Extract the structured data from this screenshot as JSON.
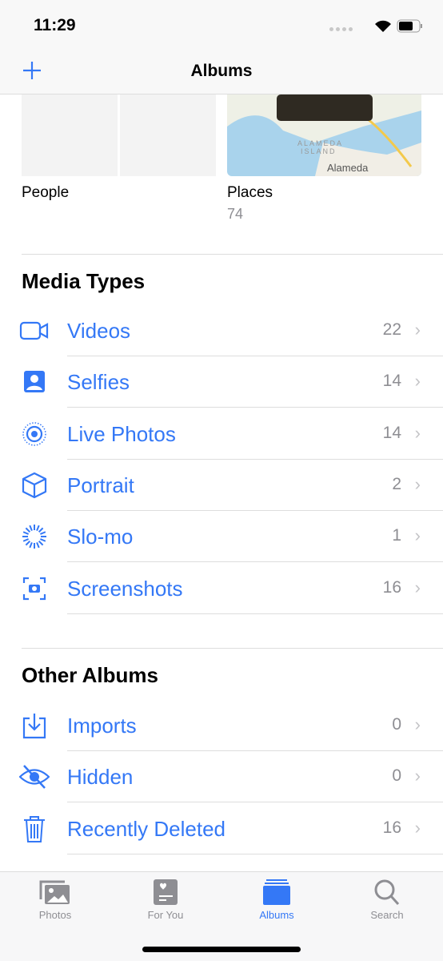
{
  "status": {
    "time": "11:29"
  },
  "nav": {
    "title": "Albums",
    "add_icon": "plus-icon"
  },
  "top_albums": [
    {
      "label": "People"
    },
    {
      "label": "Places",
      "count": "74",
      "map_labels": [
        "ALAMEDA",
        "ISLAND",
        "Alameda"
      ]
    }
  ],
  "media_types": {
    "title": "Media Types",
    "items": [
      {
        "label": "Videos",
        "count": "22",
        "icon": "video-icon"
      },
      {
        "label": "Selfies",
        "count": "14",
        "icon": "selfie-icon"
      },
      {
        "label": "Live Photos",
        "count": "14",
        "icon": "live-photo-icon"
      },
      {
        "label": "Portrait",
        "count": "2",
        "icon": "cube-icon"
      },
      {
        "label": "Slo-mo",
        "count": "1",
        "icon": "slomo-icon"
      },
      {
        "label": "Screenshots",
        "count": "16",
        "icon": "screenshot-icon"
      }
    ]
  },
  "other_albums": {
    "title": "Other Albums",
    "items": [
      {
        "label": "Imports",
        "count": "0",
        "icon": "import-icon"
      },
      {
        "label": "Hidden",
        "count": "0",
        "icon": "eye-slash-icon"
      },
      {
        "label": "Recently Deleted",
        "count": "16",
        "icon": "trash-icon"
      }
    ]
  },
  "chevron": "›",
  "tabs": [
    {
      "label": "Photos"
    },
    {
      "label": "For You"
    },
    {
      "label": "Albums",
      "active": true
    },
    {
      "label": "Search"
    }
  ],
  "colors": {
    "accent": "#3478f6",
    "secondary": "#8e8e93"
  }
}
